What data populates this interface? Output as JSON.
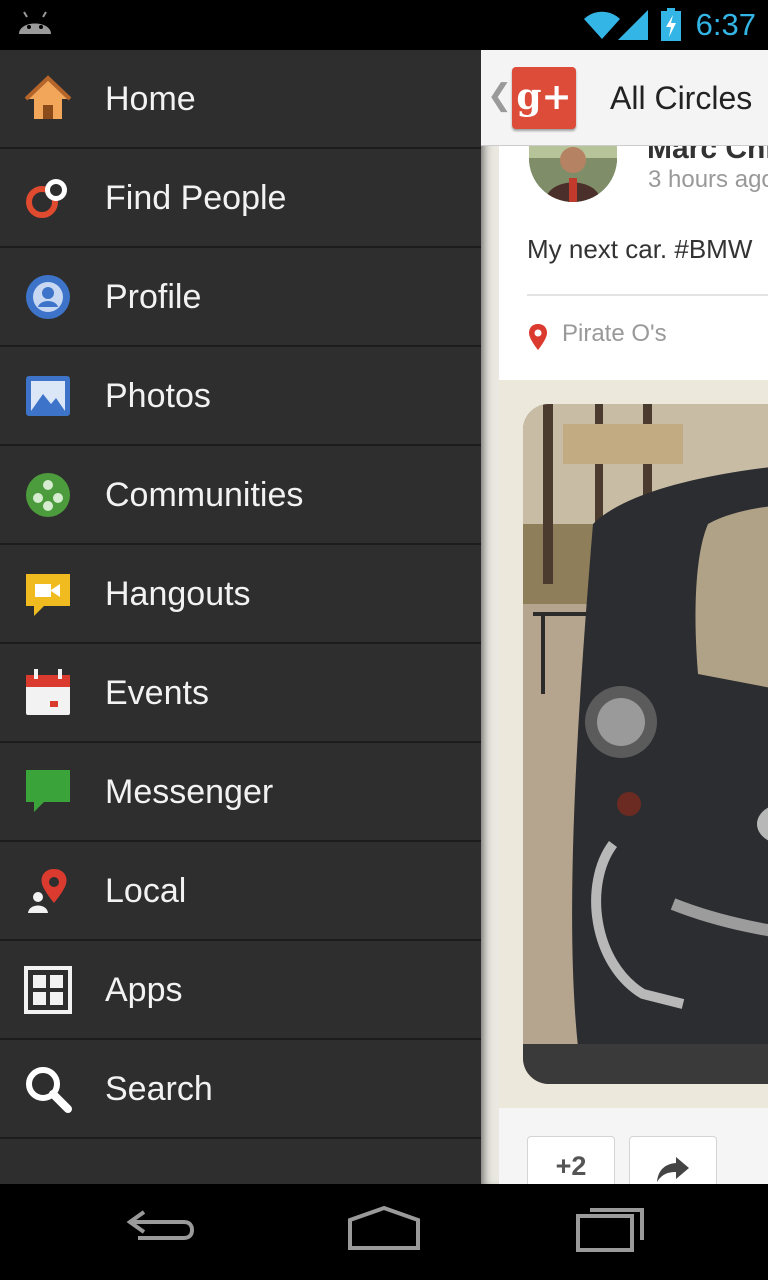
{
  "status_bar": {
    "time": "6:37",
    "accent_color": "#33b5e5",
    "icons": [
      "android-icon",
      "wifi-icon",
      "signal-icon",
      "battery-charging-icon"
    ]
  },
  "drawer": {
    "items": [
      {
        "label": "Home",
        "icon": "home-icon"
      },
      {
        "label": "Find People",
        "icon": "find-people-icon"
      },
      {
        "label": "Profile",
        "icon": "profile-icon"
      },
      {
        "label": "Photos",
        "icon": "photos-icon"
      },
      {
        "label": "Communities",
        "icon": "communities-icon"
      },
      {
        "label": "Hangouts",
        "icon": "hangouts-icon"
      },
      {
        "label": "Events",
        "icon": "events-icon"
      },
      {
        "label": "Messenger",
        "icon": "messenger-icon"
      },
      {
        "label": "Local",
        "icon": "local-icon"
      },
      {
        "label": "Apps",
        "icon": "apps-icon"
      },
      {
        "label": "Search",
        "icon": "search-icon"
      }
    ]
  },
  "action_bar": {
    "logo": "g+",
    "title": "All Circles",
    "brand_color": "#dd4b39"
  },
  "post": {
    "author": "Marc Chi",
    "time": "3 hours ago",
    "text": "My next car. #BMW",
    "location": "Pirate O's",
    "plus_count": "+2"
  }
}
